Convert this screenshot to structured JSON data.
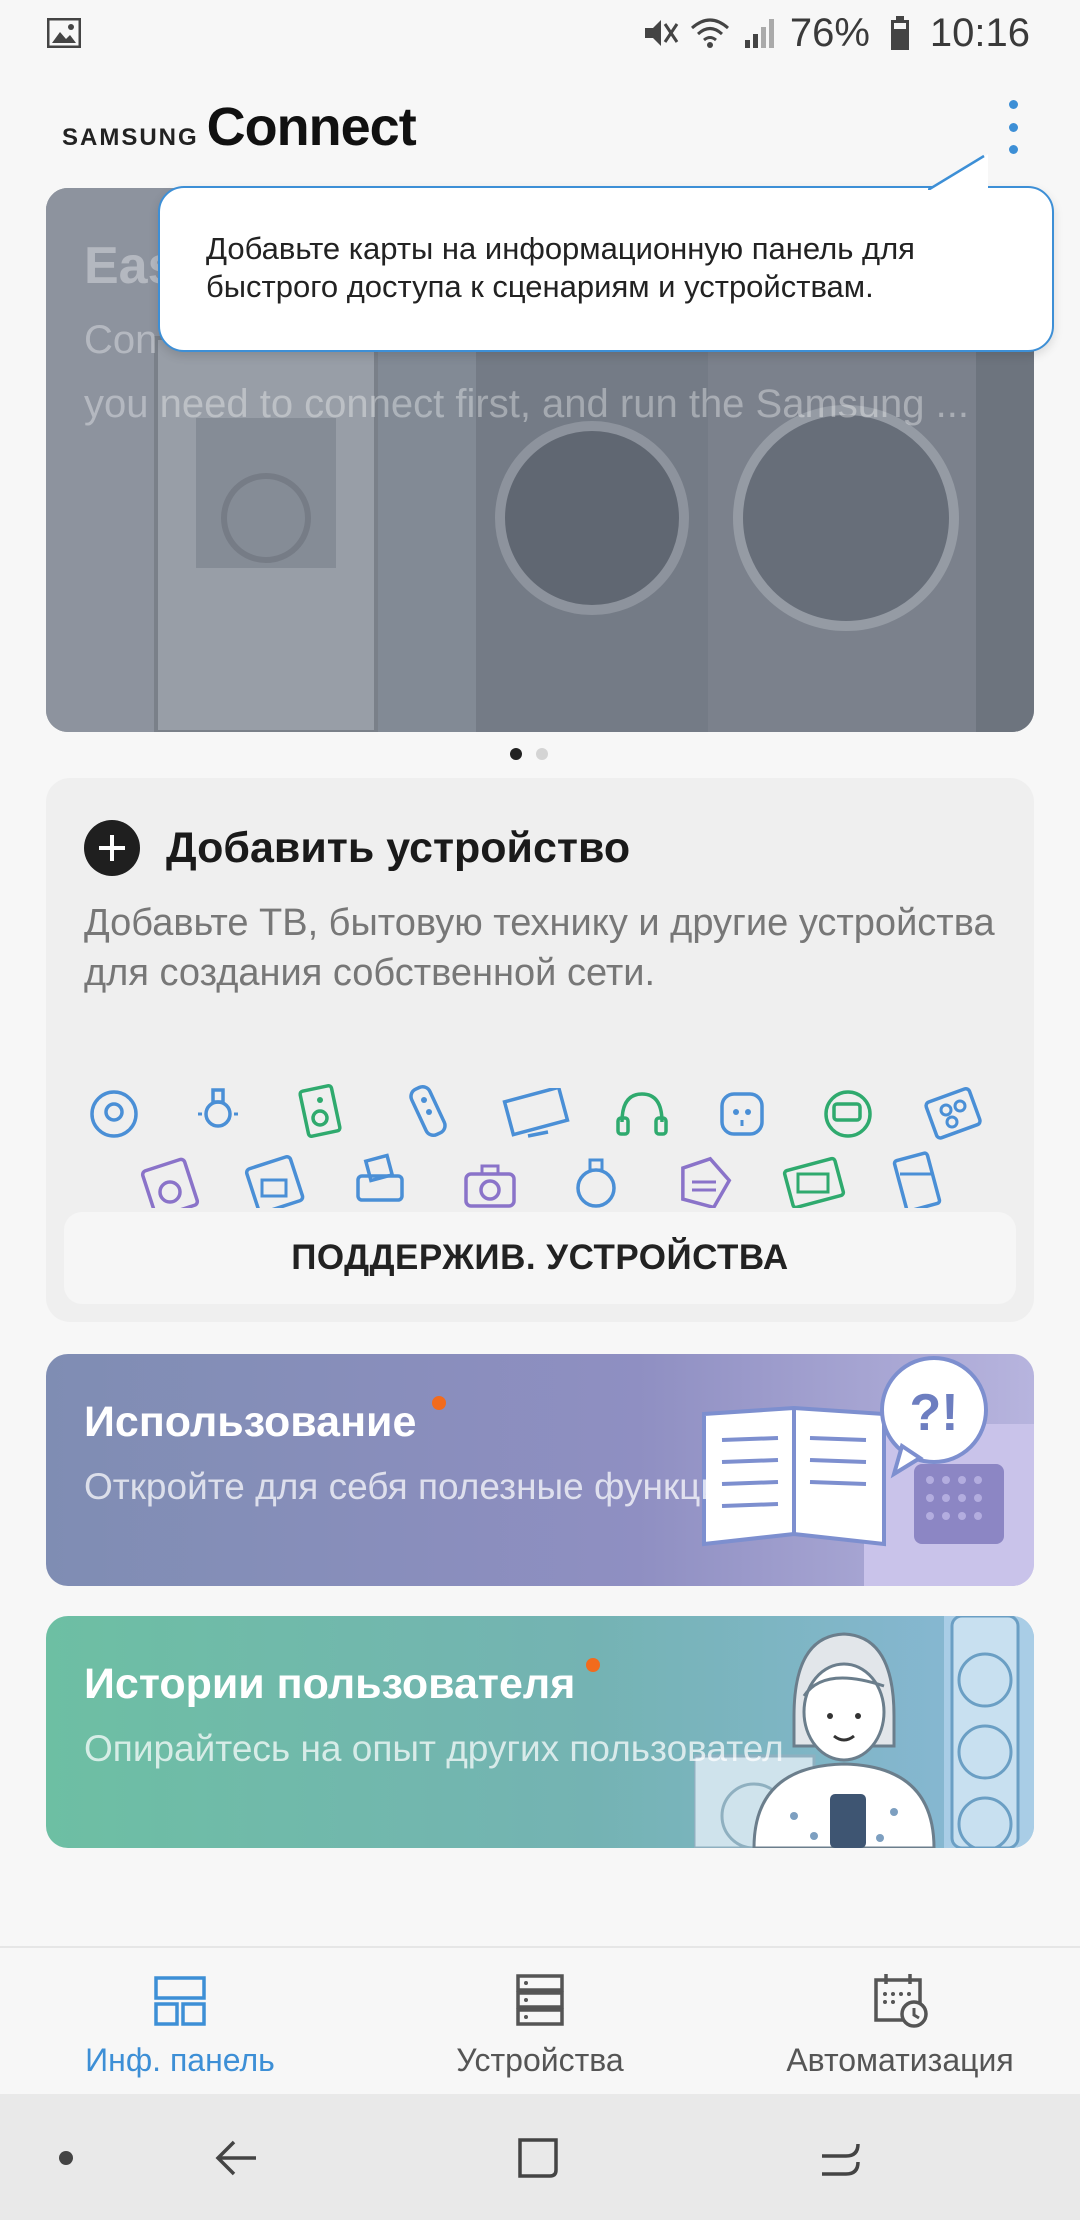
{
  "status_bar": {
    "battery": "76%",
    "time": "10:16",
    "icons": [
      "image-notification-icon",
      "mute-icon",
      "wifi-icon",
      "signal-icon",
      "battery-icon"
    ]
  },
  "app": {
    "brand_small": "SAMSUNG",
    "brand_large": "Connect",
    "menu_icon": "more-vertical-icon",
    "accent_color": "#3d8fd6"
  },
  "hero": {
    "title_partial": "Eas",
    "desc_line1": "Con",
    "desc_line2": "you need to connect first, and run the Samsung ..."
  },
  "tooltip": {
    "text": "Добавьте карты на информационную панель для быстрого доступа к сценариям и устройствам."
  },
  "pager": {
    "count": 2,
    "active_index": 0
  },
  "add_device": {
    "title": "Добавить устройство",
    "description": "Добавьте ТВ, бытовую технику и другие устройства для создания собственной сети.",
    "support_button": "ПОДДЕРЖИВ. УСТРОЙСТВА"
  },
  "cards": [
    {
      "title": "Использование",
      "description": "Откройте для себя полезные функци",
      "badge_color": "#f26b1d"
    },
    {
      "title": "Истории пользователя",
      "description": "Опирайтесь на опыт других пользовател",
      "badge_color": "#f26b1d"
    }
  ],
  "bottom_nav": {
    "items": [
      {
        "label": "Инф. панель",
        "icon": "dashboard-icon",
        "active": true
      },
      {
        "label": "Устройства",
        "icon": "devices-icon",
        "active": false
      },
      {
        "label": "Автоматизация",
        "icon": "automation-icon",
        "active": false
      }
    ]
  },
  "system_nav": [
    "dot-icon",
    "back-icon",
    "home-icon",
    "recents-icon"
  ]
}
